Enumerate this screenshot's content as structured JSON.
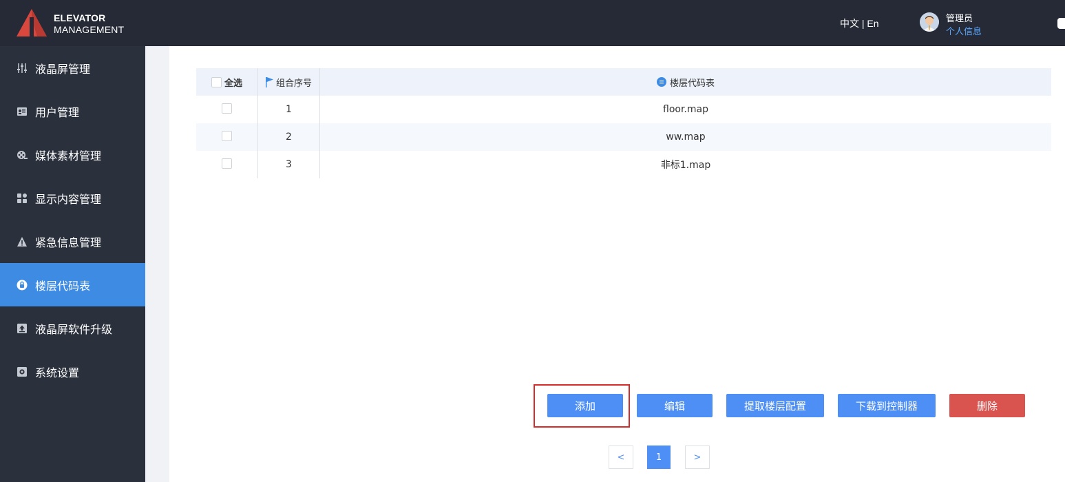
{
  "header": {
    "brand_line1": "ELEVATOR",
    "brand_line2": "MANAGEMENT",
    "lang_zh": "中文",
    "lang_sep": " | ",
    "lang_en": "En",
    "user_name": "管理员",
    "user_info_link": "个人信息"
  },
  "sidebar": {
    "items": [
      {
        "label": "液晶屏管理",
        "icon": "sliders-icon"
      },
      {
        "label": "用户管理",
        "icon": "user-card-icon"
      },
      {
        "label": "媒体素材管理",
        "icon": "media-reel-icon"
      },
      {
        "label": "显示内容管理",
        "icon": "grid-icon"
      },
      {
        "label": "紧急信息管理",
        "icon": "warning-icon"
      },
      {
        "label": "楼层代码表",
        "icon": "lock-icon",
        "active": true
      },
      {
        "label": "液晶屏软件升级",
        "icon": "upload-icon"
      },
      {
        "label": "系统设置",
        "icon": "gear-icon"
      }
    ]
  },
  "table": {
    "headers": {
      "select_all": "全选",
      "group_no": "组合序号",
      "floor_code": "楼层代码表"
    },
    "rows": [
      {
        "no": "1",
        "file": "floor.map"
      },
      {
        "no": "2",
        "file": "ww.map"
      },
      {
        "no": "3",
        "file": "非标1.map"
      }
    ]
  },
  "actions": {
    "add": "添加",
    "edit": "编辑",
    "extract": "提取楼层配置",
    "download": "下载到控制器",
    "delete": "删除"
  },
  "pagination": {
    "prev": "<",
    "current": "1",
    "next": ">"
  },
  "colors": {
    "header_bg": "#262a36",
    "sidebar_bg": "#2b303d",
    "active_blue": "#3e8be4",
    "button_blue": "#4d8ff5",
    "button_red": "#d9534f",
    "highlight_red": "#d62b2b"
  }
}
